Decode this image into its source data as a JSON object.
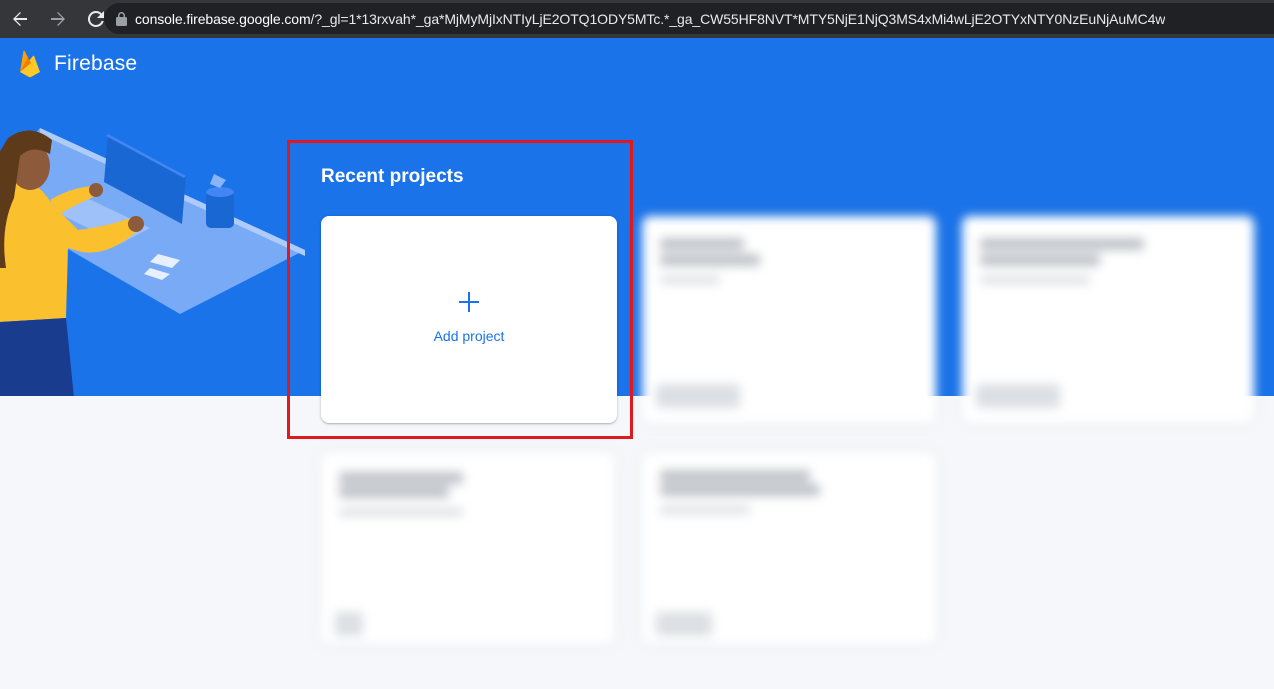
{
  "browser": {
    "url_host": "console.firebase.google.com",
    "url_path": "/?_gl=1*13rxvah*_ga*MjMyMjIxNTIyLjE2OTQ1ODY5MTc.*_ga_CW55HF8NVT*MTY5NjE1NjQ3MS4xMi4wLjE2OTYxNTY0NzEuNjAuMC4w",
    "icons": [
      "back-arrow-icon",
      "forward-arrow-icon",
      "reload-icon",
      "lock-icon"
    ]
  },
  "header": {
    "brand_name": "Firebase",
    "logo_icon": "firebase-flame-icon"
  },
  "projects": {
    "section_title": "Recent projects",
    "add_project_label": "Add project",
    "add_icon": "plus-icon"
  },
  "colors": {
    "brand_blue": "#1a73e8",
    "highlight_red": "#e0191e",
    "page_bg": "#f5f7fa",
    "chrome_bg": "#35363a"
  }
}
